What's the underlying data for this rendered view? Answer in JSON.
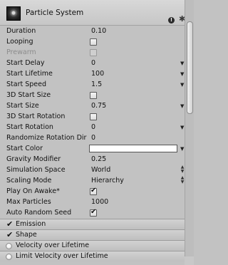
{
  "header": {
    "title": "Particle System",
    "help_glyph": "!",
    "gear_glyph": "✱"
  },
  "fields": [
    {
      "label": "Duration",
      "type": "text",
      "value": "0.10"
    },
    {
      "label": "Looping",
      "type": "check",
      "checked": false
    },
    {
      "label": "Prewarm",
      "type": "check",
      "checked": false,
      "disabled": true
    },
    {
      "label": "Start Delay",
      "type": "curve",
      "value": "0"
    },
    {
      "label": "Start Lifetime",
      "type": "curve",
      "value": "100"
    },
    {
      "label": "Start Speed",
      "type": "curve",
      "value": "1.5"
    },
    {
      "label": "3D Start Size",
      "type": "check",
      "checked": false
    },
    {
      "label": "Start Size",
      "type": "curve",
      "value": "0.75"
    },
    {
      "label": "3D Start Rotation",
      "type": "check",
      "checked": false
    },
    {
      "label": "Start Rotation",
      "type": "curve",
      "value": "0"
    },
    {
      "label": "Randomize Rotation Dir",
      "type": "text",
      "value": "0"
    },
    {
      "label": "Start Color",
      "type": "color",
      "value": "#ffffff"
    },
    {
      "label": "Gravity Modifier",
      "type": "text",
      "value": "0.25"
    },
    {
      "label": "Simulation Space",
      "type": "enum",
      "value": "World"
    },
    {
      "label": "Scaling Mode",
      "type": "enum",
      "value": "Hierarchy"
    },
    {
      "label": "Play On Awake*",
      "type": "check",
      "checked": true
    },
    {
      "label": "Max Particles",
      "type": "text",
      "value": "1000"
    },
    {
      "label": "Auto Random Seed",
      "type": "check",
      "checked": true
    }
  ],
  "modules": [
    {
      "label": "Emission",
      "enabled": true
    },
    {
      "label": "Shape",
      "enabled": true
    },
    {
      "label": "Velocity over Lifetime",
      "enabled": false
    },
    {
      "label": "Limit Velocity over Lifetime",
      "enabled": false
    }
  ],
  "glyphs": {
    "check": "✔",
    "dropdown": "▼",
    "enum_up": "▲",
    "enum_down": "▼"
  },
  "colors": {
    "panel": "#c2c2c2",
    "start_color": "#ffffff"
  }
}
